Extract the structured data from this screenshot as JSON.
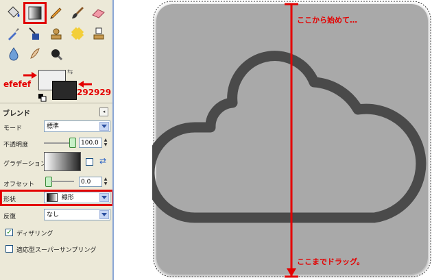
{
  "colors": {
    "foreground": "#efefef",
    "background": "#292929",
    "accent": "#e40000",
    "canvas_bg": "#a8a8a8",
    "cloud": "#4a4a4a"
  },
  "labels": {
    "foreground_hex": "efefef",
    "background_hex": "292929"
  },
  "tool_options": {
    "title": "ブレンド",
    "mode_label": "モード",
    "mode_value": "標準",
    "opacity_label": "不透明度",
    "opacity_value": "100.0",
    "gradient_label": "グラデーション",
    "offset_label": "オフセット",
    "offset_value": "0.0",
    "shape_label": "形状",
    "shape_value": "線形",
    "repeat_label": "反復",
    "repeat_value": "なし",
    "dithering_label": "ディザリング",
    "dithering_checked": true,
    "adaptive_label": "適応型スーパーサンプリング",
    "adaptive_checked": false
  },
  "annotations": {
    "start": "ここから始めて…",
    "end": "ここまでドラッグ。"
  },
  "icons": [
    "bucket-fill-icon",
    "blend-icon",
    "pencil-icon",
    "paintbrush-icon",
    "eraser-icon",
    "airbrush-icon",
    "ink-icon",
    "clone-icon",
    "heal-icon",
    "perspective-clone-icon",
    "blur-icon",
    "smudge-icon",
    "dodge-burn-icon"
  ]
}
